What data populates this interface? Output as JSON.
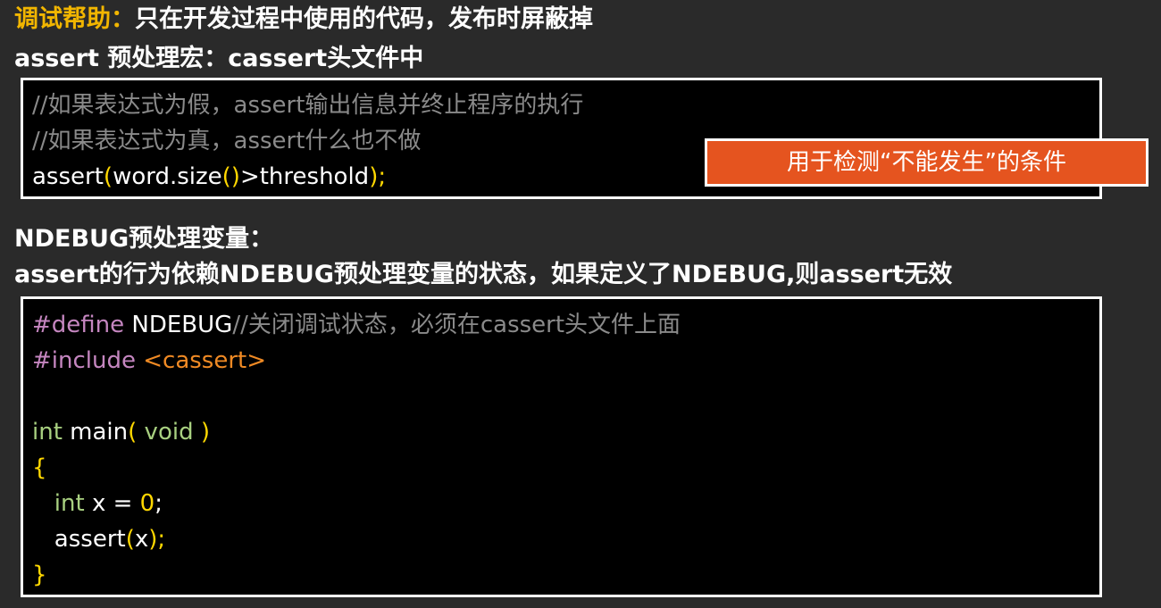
{
  "heading": {
    "prefix": "调试帮助：",
    "text": "只在开发过程中使用的代码，发布时屏蔽掉"
  },
  "assert_heading": "assert 预处理宏：cassert头文件中",
  "code1": {
    "comment1": "//如果表达式为假，assert输出信息并终止程序的执行",
    "comment2": "//如果表达式为真，assert什么也不做",
    "stmt_a": "assert",
    "stmt_b": "(",
    "stmt_c": "word.size",
    "stmt_d": "()",
    "stmt_e": ">threshold",
    "stmt_f": ");"
  },
  "callout": "用于检测“不能发生”的条件",
  "ndebug_heading": "NDEBUG预处理变量：",
  "ndebug_desc": "assert的行为依赖NDEBUG预处理变量的状态，如果定义了NDEBUG,则assert无效",
  "code2": {
    "define_kw": "#define",
    "define_name": " NDEBUG",
    "define_comment": "//关闭调试状态，必须在cassert头文件上面",
    "include_kw": "#include",
    "include_hdr": " <cassert>",
    "main_type": "int",
    "main_name": " main",
    "main_lp": "(",
    "main_void": " void",
    "main_rp": " )",
    "open_brace": "{",
    "decl_type": "   int",
    "decl_rest": " x = ",
    "decl_zero": "0",
    "decl_semi": ";",
    "assert_a": "   assert",
    "assert_b": "(",
    "assert_c": "x",
    "assert_d": ");",
    "close_brace": "}"
  }
}
